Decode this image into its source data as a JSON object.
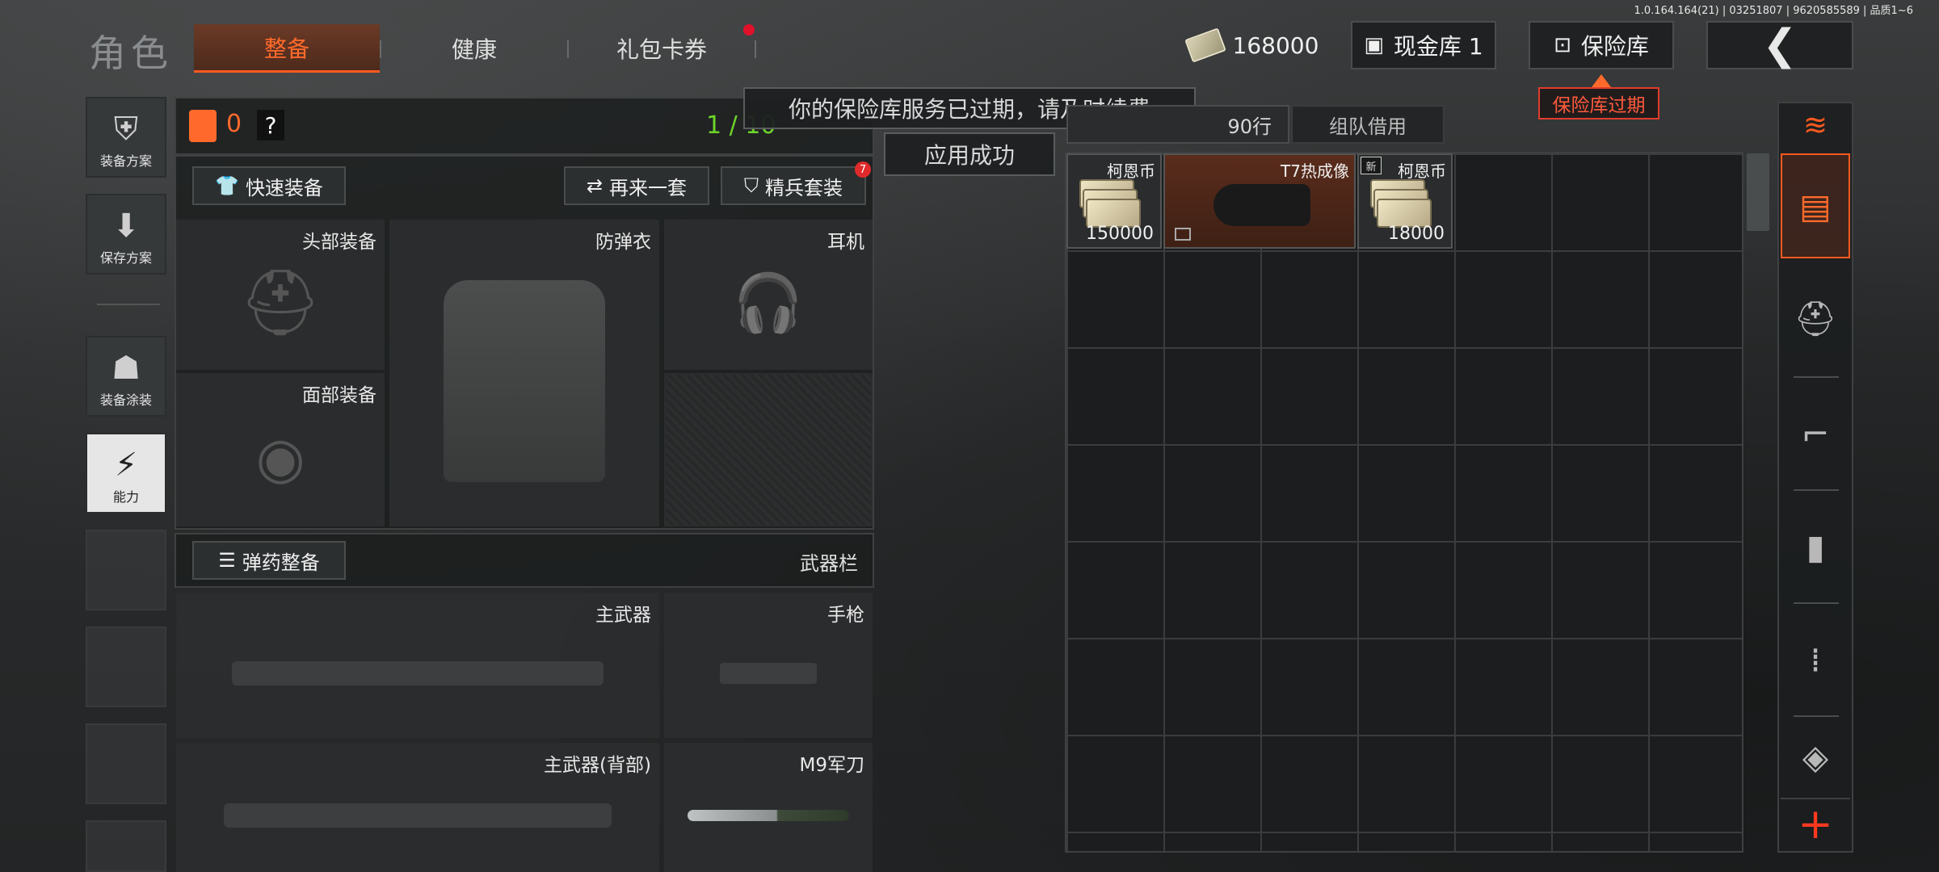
{
  "version": "1.0.164.164(21) | 03251807 | 9620585589 | 品质1~6",
  "header": {
    "title": "角色",
    "tabs": [
      {
        "label": "整备",
        "active": true
      },
      {
        "label": "健康",
        "active": false
      },
      {
        "label": "礼包卡券",
        "active": false
      }
    ],
    "currency": "168000",
    "cash_vault": "现金库 1",
    "safe_box": "保险库",
    "safe_box_expired": "保险库过期",
    "back_icon": "chevron-left-icon"
  },
  "left_nav": [
    {
      "label": "装备方案",
      "icon": "vest-icon"
    },
    {
      "label": "保存方案",
      "icon": "download-icon"
    },
    {
      "label": "装备涂装",
      "icon": "helmet-paint-icon"
    },
    {
      "label": "能力",
      "icon": "ability-icon"
    }
  ],
  "loadout": {
    "armor_level": "0",
    "unknown": "?",
    "count": "1 / 10",
    "quick_equip": "快速装备",
    "again": "再来一套",
    "elite_set": "精兵套装",
    "elite_badge": "7",
    "slots": {
      "head": "头部装备",
      "vest": "防弹衣",
      "earphone": "耳机",
      "face": "面部装备",
      "main_weapon": "主武器",
      "pistol": "手枪",
      "main_weapon_back": "主武器(背部)",
      "knife": "M9军刀"
    },
    "ammo": "弹药整备",
    "weapon_bar": "武器栏"
  },
  "toasts": {
    "expired_notice": "你的保险库服务已过期，请及时续费",
    "apply_success": "应用成功"
  },
  "storage": {
    "tab_rows": "90行",
    "team_borrow": "组队借用",
    "items": [
      {
        "name": "柯恩币",
        "value": "150000",
        "kind": "cash"
      },
      {
        "name": "T7热成像",
        "value": "",
        "kind": "scope"
      },
      {
        "name": "柯恩币",
        "value": "18000",
        "kind": "cash",
        "badge": "新"
      }
    ]
  },
  "right_categories": [
    "stack-refresh-icon",
    "container-icon",
    "helmet-icon",
    "rifle-icon",
    "magazine-icon",
    "ammo-icon",
    "sight-icon"
  ],
  "add_label": "+"
}
